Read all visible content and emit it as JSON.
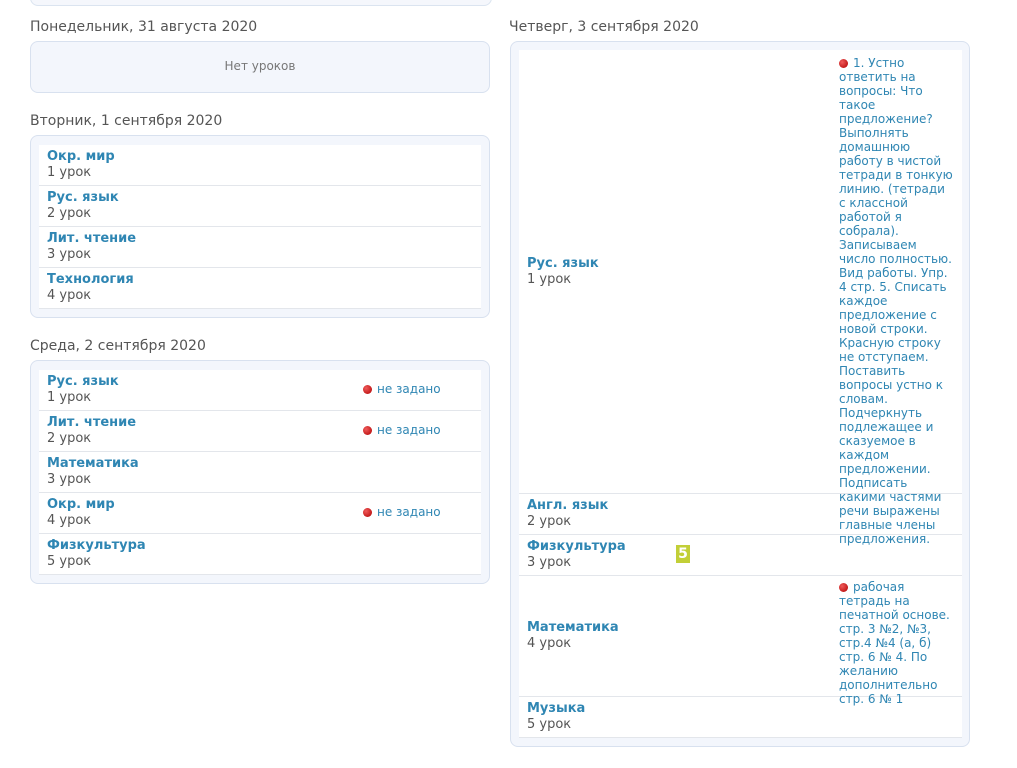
{
  "days": {
    "mon": {
      "title": "Понедельник, 31 августа 2020",
      "empty": "Нет уроков"
    },
    "tue": {
      "title": "Вторник, 1 сентября 2020",
      "lessons": [
        {
          "subject": "Окр. мир",
          "num": "1 урок"
        },
        {
          "subject": "Рус. язык",
          "num": "2 урок"
        },
        {
          "subject": "Лит. чтение",
          "num": "3 урок"
        },
        {
          "subject": "Технология",
          "num": "4 урок"
        }
      ]
    },
    "wed": {
      "title": "Среда, 2 сентября 2020",
      "lessons": [
        {
          "subject": "Рус. язык",
          "num": "1 урок",
          "status": "не задано"
        },
        {
          "subject": "Лит. чтение",
          "num": "2 урок",
          "status": "не задано"
        },
        {
          "subject": "Математика",
          "num": "3 урок"
        },
        {
          "subject": "Окр. мир",
          "num": "4 урок",
          "status": "не задано"
        },
        {
          "subject": "Физкультура",
          "num": "5 урок"
        }
      ]
    },
    "thu": {
      "title": "Четверг, 3 сентября 2020",
      "lessons": [
        {
          "subject": "Рус. язык",
          "num": "1 урок",
          "homework": "1. Устно ответить на вопросы: Что такое предложение? Выполнять домашнюю работу в чистой тетради в тонкую линию. (тетради с классной работой я собрала). Записываем число полностью. Вид работы. Упр. 4 стр. 5. Списать каждое предложение с новой строки. Красную строку не отступаем. Поставить вопросы устно к словам. Подчеркнуть подлежащее и сказуемое в каждом предложении. Подписать какими частями речи выражены главные члены предложения."
        },
        {
          "subject": "Англ. язык",
          "num": "2 урок"
        },
        {
          "subject": "Физкультура",
          "num": "3 урок",
          "grade": "5"
        },
        {
          "subject": "Математика",
          "num": "4 урок",
          "homework": "рабочая тетрадь на печатной основе. стр. 3 №2, №3, стр.4 №4 (а, б) стр. 6 № 4. По желанию дополнительно стр. 6 № 1"
        },
        {
          "subject": "Музыка",
          "num": "5 урок"
        }
      ]
    }
  },
  "colors": {
    "link": "#2f86b3",
    "grade_bg": "#c2cf37",
    "dot": "#c00000"
  },
  "icons": {
    "status_dot": "red-dot-icon"
  }
}
